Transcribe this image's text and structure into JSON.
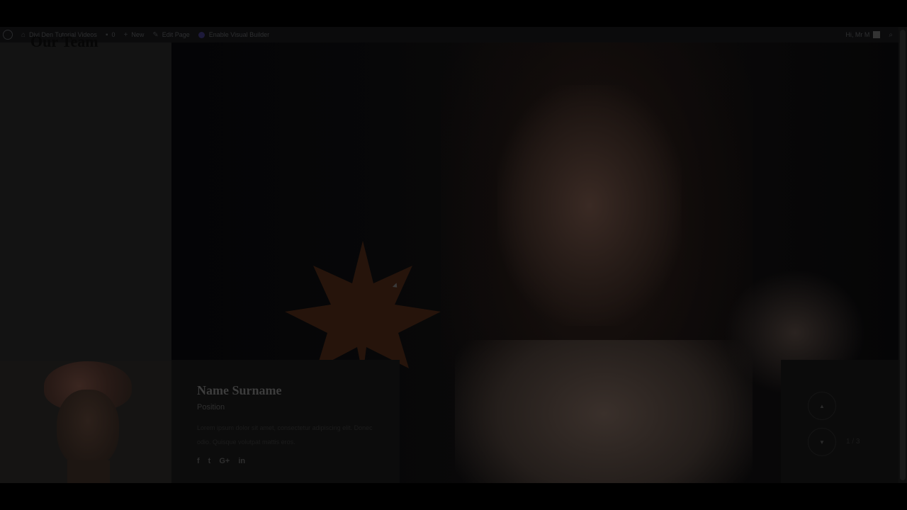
{
  "admin_bar": {
    "site_name": "Divi Den Tutorial Videos",
    "comments_count": "0",
    "new_label": "New",
    "edit_label": "Edit Page",
    "visual_builder_label": "Enable Visual Builder",
    "greeting": "Hi, Mr M"
  },
  "page": {
    "heading": "Our Team"
  },
  "team_member": {
    "name": "Name Surname",
    "position": "Position",
    "bio": "Lorem ipsum dolor sit amet, consectetur adipiscing elit. Donec odio. Quisque volutpat mattis eros."
  },
  "social": {
    "facebook": "f",
    "twitter": "t",
    "google_plus": "G+",
    "linkedin": "in"
  },
  "slider": {
    "counter": "1 / 3"
  },
  "colors": {
    "overlay": "#000000",
    "card_bg": "#0c0c0c",
    "panel_bg": "#131313"
  }
}
